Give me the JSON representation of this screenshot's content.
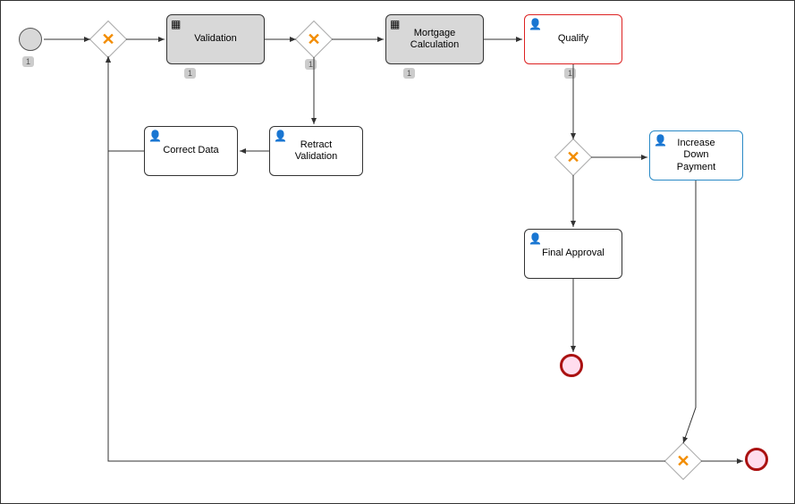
{
  "diagram_type": "BPMN process diagram",
  "nodes": {
    "start": {
      "kind": "start-event"
    },
    "gw1": {
      "kind": "exclusive-gateway"
    },
    "validation": {
      "kind": "business-rule-task",
      "label": "Validation",
      "fill": "gray"
    },
    "gw2": {
      "kind": "exclusive-gateway"
    },
    "mortgage_calc": {
      "kind": "business-rule-task",
      "label": "Mortgage\nCalculation",
      "fill": "gray"
    },
    "qualify": {
      "kind": "user-task",
      "label": "Qualify",
      "border": "red"
    },
    "retract_validation": {
      "kind": "user-task",
      "label": "Retract\nValidation"
    },
    "correct_data": {
      "kind": "user-task",
      "label": "Correct Data"
    },
    "gw3": {
      "kind": "exclusive-gateway"
    },
    "increase_down": {
      "kind": "user-task",
      "label": "Increase\nDown\nPayment",
      "border": "blue"
    },
    "final_approval": {
      "kind": "user-task",
      "label": "Final Approval"
    },
    "end1": {
      "kind": "end-event"
    },
    "gw4": {
      "kind": "exclusive-gateway"
    },
    "end2": {
      "kind": "end-event"
    }
  },
  "badges": {
    "b1": "1",
    "b2": "1",
    "b3": "1",
    "b4": "1",
    "b5": "1"
  },
  "edges": [
    {
      "from": "start",
      "to": "gw1"
    },
    {
      "from": "gw1",
      "to": "validation"
    },
    {
      "from": "validation",
      "to": "gw2"
    },
    {
      "from": "gw2",
      "to": "mortgage_calc"
    },
    {
      "from": "mortgage_calc",
      "to": "qualify"
    },
    {
      "from": "gw2",
      "to": "retract_validation"
    },
    {
      "from": "retract_validation",
      "to": "correct_data"
    },
    {
      "from": "correct_data",
      "to": "gw1",
      "routing": "down-left-up"
    },
    {
      "from": "qualify",
      "to": "gw3"
    },
    {
      "from": "gw3",
      "to": "increase_down"
    },
    {
      "from": "gw3",
      "to": "final_approval"
    },
    {
      "from": "final_approval",
      "to": "end1"
    },
    {
      "from": "increase_down",
      "to": "gw4"
    },
    {
      "from": "gw4",
      "to": "end2"
    },
    {
      "from": "gw4",
      "to": "gw1",
      "routing": "left"
    }
  ]
}
